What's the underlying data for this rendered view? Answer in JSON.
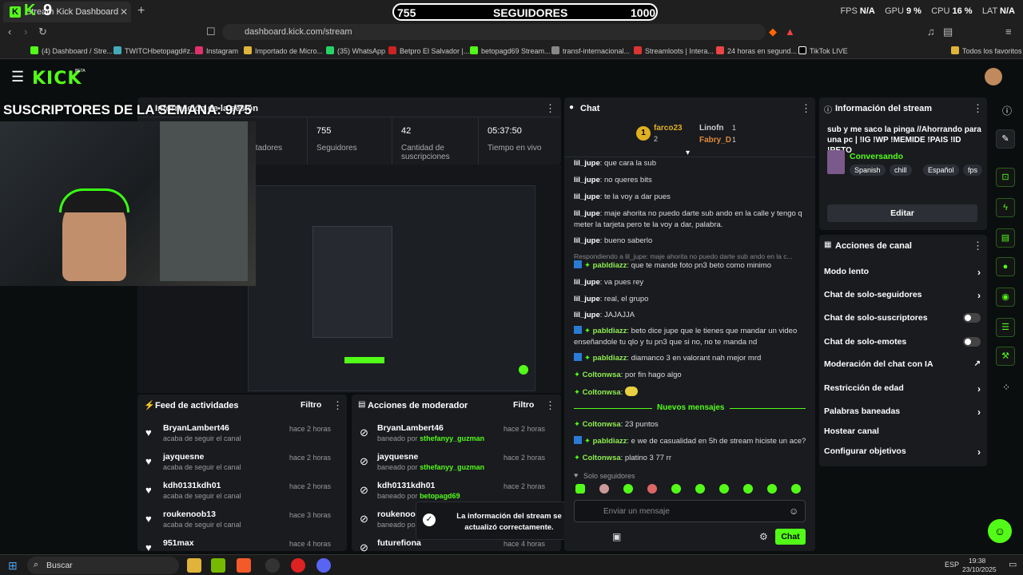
{
  "browser": {
    "tab_title": "Stream Kick Dashboard",
    "address": "dashboard.kick.com/stream",
    "bookmarks": [
      "(4) Dashboard / Stre...",
      "TWITCHbetopagd#z...",
      "Instagram",
      "Importado de Micro...",
      "(35) WhatsApp",
      "Betpro El Salvador |...",
      "betopagd69 Stream...",
      "transf-internacional...",
      "Streamloots | Intera...",
      "24 horas en segund...",
      "TikTok LIVE",
      "Todos los favoritos"
    ]
  },
  "overlay": {
    "followers_current": "755",
    "followers_label": "SEGUIDORES",
    "followers_goal": "1000",
    "subs_week": "SUSCRIPTORES DE LA SEMANA: 9/75",
    "fps_label": "FPS",
    "fps_value": "N/A",
    "gpu_label": "GPU",
    "gpu_value": "9 %",
    "cpu_label": "CPU",
    "cpu_value": "16 %",
    "lat_label": "LAT",
    "lat_value": "N/A",
    "tab_number": "9"
  },
  "header": {
    "logo": "KICK",
    "beta": "BETA"
  },
  "session": {
    "title": "Información de la sesión",
    "viewers_label": "Espectadores",
    "followers_value": "755",
    "followers_label": "Seguidores",
    "subs_value": "42",
    "subs_label": "Cantidad de suscripciones",
    "live_value": "05:37:50",
    "live_label": "Tiempo en vivo"
  },
  "feed": {
    "title": "Feed de actividades",
    "filter": "Filtro",
    "items": [
      {
        "name": "BryanLambert46",
        "sub": "acaba de seguir el canal",
        "time": "hace 2 horas"
      },
      {
        "name": "jayquesne",
        "sub": "acaba de seguir el canal",
        "time": "hace 2 horas"
      },
      {
        "name": "kdh0131kdh01",
        "sub": "acaba de seguir el canal",
        "time": "hace 2 horas"
      },
      {
        "name": "roukenoob13",
        "sub": "acaba de seguir el canal",
        "time": "hace 3 horas"
      },
      {
        "name": "951max",
        "sub": "",
        "time": "hace 4 horas"
      }
    ]
  },
  "mod": {
    "title": "Acciones de moderador",
    "filter": "Filtro",
    "items": [
      {
        "name": "BryanLambert46",
        "by": "baneado por",
        "mod": "sthefanyy_guzman",
        "time": "hace 2 horas"
      },
      {
        "name": "jayquesne",
        "by": "baneado por",
        "mod": "sthefanyy_guzman",
        "time": "hace 2 horas"
      },
      {
        "name": "kdh0131kdh01",
        "by": "baneado por",
        "mod": "betopagd69",
        "time": "hace 2 horas"
      },
      {
        "name": "roukenoob1",
        "by": "baneado por",
        "mod": "",
        "time": ""
      },
      {
        "name": "futurefiona",
        "by": "",
        "mod": "",
        "time": "hace 4 horas"
      }
    ]
  },
  "toast": {
    "text": "La información del stream se actualizó correctamente."
  },
  "chat": {
    "title": "Chat",
    "top": [
      {
        "name": "farco23",
        "count": "2"
      },
      {
        "name": "Linofn",
        "count": "1"
      },
      {
        "name": "Fabry_D",
        "count": "1"
      }
    ],
    "messages": [
      {
        "user": "lil_jupe",
        "text": "que cara la sub"
      },
      {
        "user": "lil_jupe",
        "text": "no queres bits"
      },
      {
        "user": "lil_jupe",
        "text": "te la voy a dar pues"
      },
      {
        "user": "lil_jupe",
        "text": "maje ahorita no puedo darte sub ando en la calle y tengo q meter la tarjeta pero te la voy a dar, palabra."
      },
      {
        "user": "lil_jupe",
        "text": "bueno saberlo"
      },
      {
        "user": "pabldiazz",
        "text": "que te mande foto pn3 beto como minimo",
        "reply": "Respondiendo a lil_jupe: maje ahorita no puedo darte sub ando en la c..."
      },
      {
        "user": "lil_jupe",
        "text": "va pues rey"
      },
      {
        "user": "lil_jupe",
        "text": "real, el grupo"
      },
      {
        "user": "lil_jupe",
        "text": "JAJAJJA"
      },
      {
        "user": "pabldiazz",
        "text": "beto dice jupe que le tienes que mandar un video enseñandole tu qlo y tu pn3 que si no, no te manda nd"
      },
      {
        "user": "pabldiazz",
        "text": "diamanco 3 en valorant nah mejor mrd"
      },
      {
        "user": "Coltonwsa",
        "text": "por fin hago algo"
      },
      {
        "user": "Coltonwsa",
        "text": ""
      }
    ],
    "new_label": "Nuevos mensajes",
    "new_messages": [
      {
        "user": "Coltonwsa",
        "text": "23 puntos"
      },
      {
        "user": "pabldiazz",
        "text": "e we de casualidad en 5h de stream hiciste un ace?"
      },
      {
        "user": "Coltonwsa",
        "text": "platino 3 77 rr"
      }
    ],
    "followers_only": "Solo seguidores",
    "input_placeholder": "Enviar un mensaje",
    "send_label": "Chat"
  },
  "stream_info": {
    "title": "Información del stream",
    "stream_title": "sub y me saco la pinga //Ahorrando para una pc | !IG !WP !MEMIDE !PAIS !ID !RETO",
    "category": "Conversando",
    "tags": [
      "Spanish",
      "chill",
      "Español",
      "fps"
    ],
    "edit_label": "Editar"
  },
  "channel_actions": {
    "title": "Acciones de canal",
    "items": [
      {
        "label": "Modo lento",
        "kind": "chevron"
      },
      {
        "label": "Chat de solo-seguidores",
        "kind": "chevron"
      },
      {
        "label": "Chat de solo-suscriptores",
        "kind": "toggle"
      },
      {
        "label": "Chat de solo-emotes",
        "kind": "toggle"
      },
      {
        "label": "Moderación del chat con IA",
        "kind": "ext"
      },
      {
        "label": "Restricción de edad",
        "kind": "chevron"
      },
      {
        "label": "Palabras baneadas",
        "kind": "chevron"
      },
      {
        "label": "Hostear canal",
        "kind": "none"
      },
      {
        "label": "Configurar objetivos",
        "kind": "chevron"
      }
    ]
  },
  "taskbar": {
    "search": "Buscar",
    "lang": "ESP",
    "time": "19:38",
    "date": "23/10/2025"
  }
}
